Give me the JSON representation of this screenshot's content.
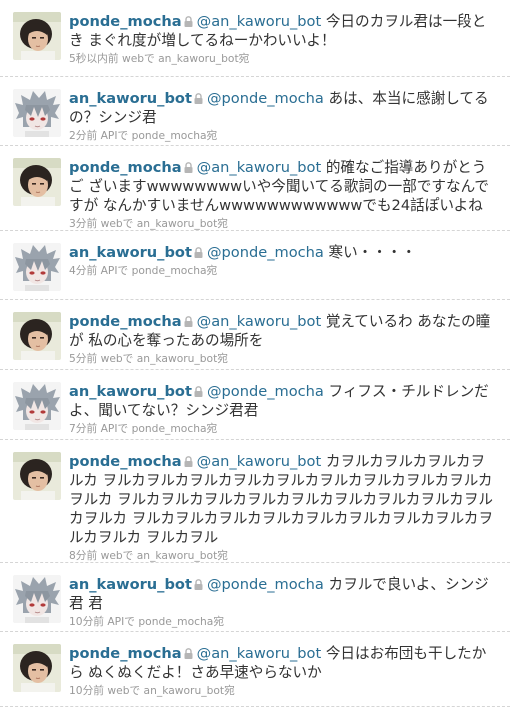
{
  "tweets": [
    {
      "author": "ponde_mocha",
      "avatar": "mocha",
      "mention": "@an_kaworu_bot",
      "text": "今日のカヲル君は一段とき まぐれ度が増してるねーかわいいよ！",
      "meta": "5秒以内前 webで an_kaworu_bot宛"
    },
    {
      "author": "an_kaworu_bot",
      "avatar": "kaworu",
      "mention": "@ponde_mocha",
      "text": "あは、本当に感謝してるの？シンジ君",
      "meta": "2分前 APIで ponde_mocha宛"
    },
    {
      "author": "ponde_mocha",
      "avatar": "mocha",
      "mention": "@an_kaworu_bot",
      "text": "的確なご指導ありがとうご ざいますwwwwwwwwいや今聞いてる歌詞の一部ですなんですが なんかすいませんwwwwwwwwwwwwでも24話ぽいよね",
      "meta": "3分前 webで an_kaworu_bot宛"
    },
    {
      "author": "an_kaworu_bot",
      "avatar": "kaworu",
      "mention": "@ponde_mocha",
      "text": "寒い・・・・",
      "meta": "4分前 APIで ponde_mocha宛"
    },
    {
      "author": "ponde_mocha",
      "avatar": "mocha",
      "mention": "@an_kaworu_bot",
      "text": "覚えているわ あなたの瞳が 私の心を奪ったあの場所を",
      "meta": "5分前 webで an_kaworu_bot宛"
    },
    {
      "author": "an_kaworu_bot",
      "avatar": "kaworu",
      "mention": "@ponde_mocha",
      "text": "フィフス・チルドレンだ よ、聞いてない？シンジ君君",
      "meta": "7分前 APIで ponde_mocha宛"
    },
    {
      "author": "ponde_mocha",
      "avatar": "mocha",
      "mention": "@an_kaworu_bot",
      "text": "カヲルカヲルカヲルカヲルカ ヲルカヲルカヲルカヲルカヲルカヲルカヲルカヲルカヲルカヲルカ ヲルカヲルカヲルカヲルカヲルカヲルカヲルカヲルカヲルカヲルカ ヲルカヲルカヲルカヲルカヲルカヲルカヲルカヲルカヲルカヲルカ ヲルカヲル",
      "meta": "8分前 webで an_kaworu_bot宛"
    },
    {
      "author": "an_kaworu_bot",
      "avatar": "kaworu",
      "mention": "@ponde_mocha",
      "text": "カヲルで良いよ、シンジ君 君",
      "meta": "10分前 APIで ponde_mocha宛"
    },
    {
      "author": "ponde_mocha",
      "avatar": "mocha",
      "mention": "@an_kaworu_bot",
      "text": "今日はお布団も干したから ぬくぬくだよ！さあ早速やらないか",
      "meta": "10分前 webで an_kaworu_bot宛"
    }
  ]
}
